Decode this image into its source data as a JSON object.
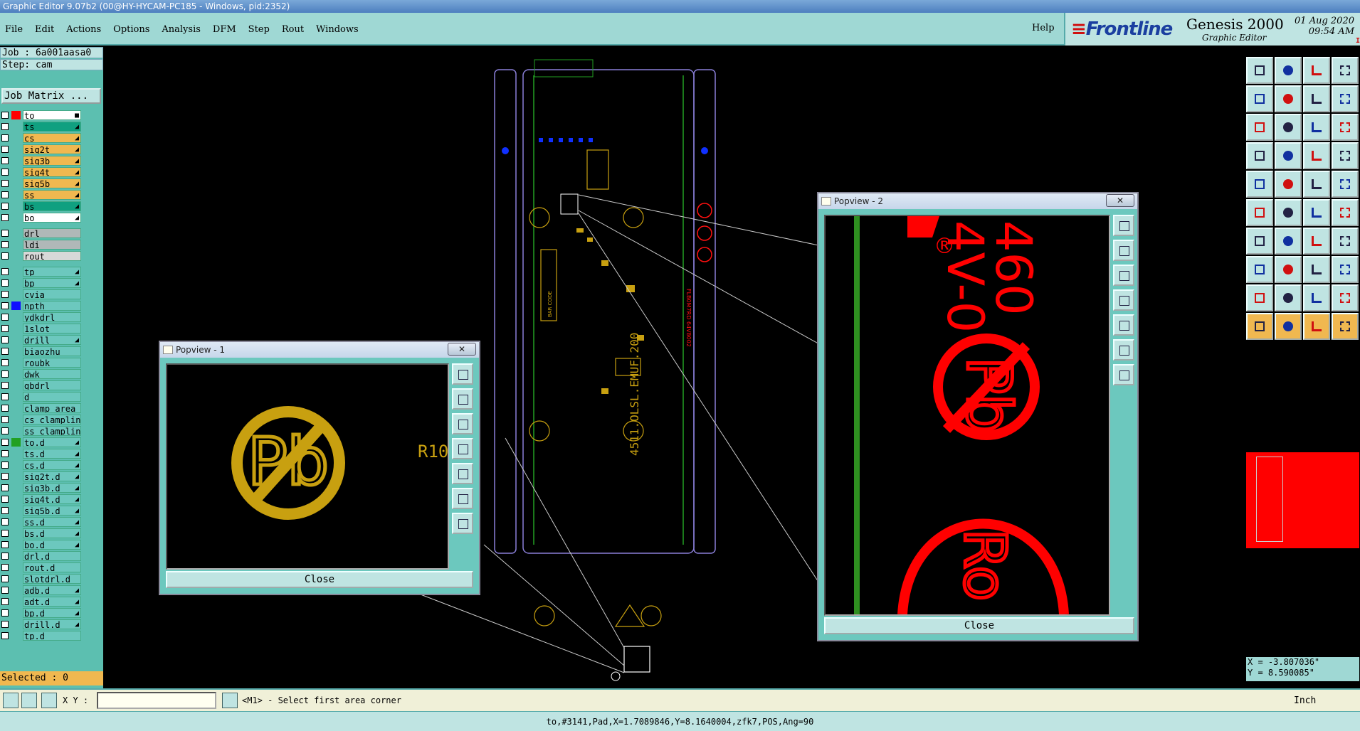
{
  "window": {
    "title": "Graphic Editor 9.07b2 (00@HY-HYCAM-PC185 - Windows, pid:2352)"
  },
  "menu": {
    "items": [
      "File",
      "Edit",
      "Actions",
      "Options",
      "Analysis",
      "DFM",
      "Step",
      "Rout",
      "Windows"
    ],
    "help": "Help"
  },
  "brand": {
    "logo": "Frontline",
    "product": "Genesis 2000",
    "subtitle": "Graphic Editor",
    "date": "01 Aug 2020",
    "time": "09:54 AM",
    "pause_mark": "II"
  },
  "job": {
    "job_line": "Job : 6a001aasa0",
    "step_line": "Step: cam",
    "matrix_button": "Job Matrix ..."
  },
  "layers": [
    {
      "name": "to",
      "color": "#ffffff",
      "swatch": "#ff0000",
      "mark": "■"
    },
    {
      "name": "ts",
      "color": "#10a080",
      "swatch": "",
      "mark": "◢"
    },
    {
      "name": "cs",
      "color": "#f0b850",
      "swatch": "",
      "mark": "◢"
    },
    {
      "name": "sig2t",
      "color": "#f0b850",
      "swatch": "",
      "mark": "◢"
    },
    {
      "name": "sig3b",
      "color": "#f0b850",
      "swatch": "",
      "mark": "◢"
    },
    {
      "name": "sig4t",
      "color": "#f0b850",
      "swatch": "",
      "mark": "◢"
    },
    {
      "name": "sig5b",
      "color": "#f0b850",
      "swatch": "",
      "mark": "◢"
    },
    {
      "name": "ss",
      "color": "#f0b850",
      "swatch": "",
      "mark": "◢"
    },
    {
      "name": "bs",
      "color": "#10a080",
      "swatch": "",
      "mark": "◢"
    },
    {
      "name": "bo",
      "color": "#ffffff",
      "swatch": "",
      "mark": "◢"
    },
    {
      "name": "drl",
      "color": "#b0b8b8",
      "swatch": "",
      "mark": ""
    },
    {
      "name": "ldi",
      "color": "#b0b8b8",
      "swatch": "",
      "mark": ""
    },
    {
      "name": "rout",
      "color": "#d8d8d8",
      "swatch": "",
      "mark": ""
    },
    {
      "name": "tp",
      "color": "#6cc8be",
      "swatch": "",
      "mark": "◢"
    },
    {
      "name": "bp",
      "color": "#6cc8be",
      "swatch": "",
      "mark": "◢"
    },
    {
      "name": "cvia",
      "color": "#6cc8be",
      "swatch": "",
      "mark": ""
    },
    {
      "name": "npth",
      "color": "#6cc8be",
      "swatch": "#1010ff",
      "mark": ""
    },
    {
      "name": "ydkdrl",
      "color": "#6cc8be",
      "swatch": "",
      "mark": ""
    },
    {
      "name": "1slot",
      "color": "#6cc8be",
      "swatch": "",
      "mark": ""
    },
    {
      "name": "drill",
      "color": "#6cc8be",
      "swatch": "",
      "mark": "◢"
    },
    {
      "name": "biaozhu",
      "color": "#6cc8be",
      "swatch": "",
      "mark": ""
    },
    {
      "name": "roubk",
      "color": "#6cc8be",
      "swatch": "",
      "mark": ""
    },
    {
      "name": "dwk",
      "color": "#6cc8be",
      "swatch": "",
      "mark": ""
    },
    {
      "name": "gbdrl",
      "color": "#6cc8be",
      "swatch": "",
      "mark": ""
    },
    {
      "name": "d",
      "color": "#6cc8be",
      "swatch": "",
      "mark": ""
    },
    {
      "name": "clamp_area",
      "color": "#6cc8be",
      "swatch": "",
      "mark": ""
    },
    {
      "name": "cs_clampline",
      "color": "#6cc8be",
      "swatch": "",
      "mark": ""
    },
    {
      "name": "ss_clampline",
      "color": "#6cc8be",
      "swatch": "",
      "mark": ""
    },
    {
      "name": "to.d",
      "color": "#6cc8be",
      "swatch": "#22a022",
      "mark": "◢"
    },
    {
      "name": "ts.d",
      "color": "#6cc8be",
      "swatch": "",
      "mark": "◢"
    },
    {
      "name": "cs.d",
      "color": "#6cc8be",
      "swatch": "",
      "mark": "◢"
    },
    {
      "name": "sig2t.d",
      "color": "#6cc8be",
      "swatch": "",
      "mark": "◢"
    },
    {
      "name": "sig3b.d",
      "color": "#6cc8be",
      "swatch": "",
      "mark": "◢"
    },
    {
      "name": "sig4t.d",
      "color": "#6cc8be",
      "swatch": "",
      "mark": "◢"
    },
    {
      "name": "sig5b.d",
      "color": "#6cc8be",
      "swatch": "",
      "mark": "◢"
    },
    {
      "name": "ss.d",
      "color": "#6cc8be",
      "swatch": "",
      "mark": "◢"
    },
    {
      "name": "bs.d",
      "color": "#6cc8be",
      "swatch": "",
      "mark": "◢"
    },
    {
      "name": "bo.d",
      "color": "#6cc8be",
      "swatch": "",
      "mark": "◢"
    },
    {
      "name": "drl.d",
      "color": "#6cc8be",
      "swatch": "",
      "mark": ""
    },
    {
      "name": "rout.d",
      "color": "#6cc8be",
      "swatch": "",
      "mark": ""
    },
    {
      "name": "slotdrl.d",
      "color": "#6cc8be",
      "swatch": "",
      "mark": ""
    },
    {
      "name": "adb.d",
      "color": "#6cc8be",
      "swatch": "",
      "mark": "◢"
    },
    {
      "name": "adt.d",
      "color": "#6cc8be",
      "swatch": "",
      "mark": "◢"
    },
    {
      "name": "bp.d",
      "color": "#6cc8be",
      "swatch": "",
      "mark": "◢"
    },
    {
      "name": "drill.d",
      "color": "#6cc8be",
      "swatch": "",
      "mark": "◢"
    },
    {
      "name": "tp.d",
      "color": "#6cc8be",
      "swatch": "",
      "mark": ""
    }
  ],
  "selected": "Selected : 0",
  "board": {
    "text_vertical": "4511.OLSL.EMUF.200",
    "bar_code_label": "BAR CODE",
    "red_text": "FLB0M7RD 64V8002"
  },
  "popview1": {
    "title": "Popview - 1",
    "close_x": "✕",
    "close_label": "Close",
    "pb_text": "Pb",
    "ref_text": "R10"
  },
  "popview2": {
    "title": "Popview - 2",
    "close_x": "✕",
    "close_label": "Close",
    "text_460": "460",
    "text_4v0": "4V-0",
    "registered": "®",
    "pb_text": "Pb",
    "ro_text": "Ro"
  },
  "colors": {
    "gold": "#c8a010",
    "red": "#ff0000",
    "teal": "#6cc8be",
    "panel": "#bfe4e2"
  },
  "readout": {
    "x": "X = -3.807036\"",
    "y": "Y = 8.590085\""
  },
  "cmd": {
    "xy_label": "X Y :",
    "xy_value": "",
    "message": "<M1> - Select first area corner",
    "units": "Inch"
  },
  "status": "to,#3141,Pad,X=1.7089846,Y=8.1640004,zfk7,POS,Ang=90"
}
